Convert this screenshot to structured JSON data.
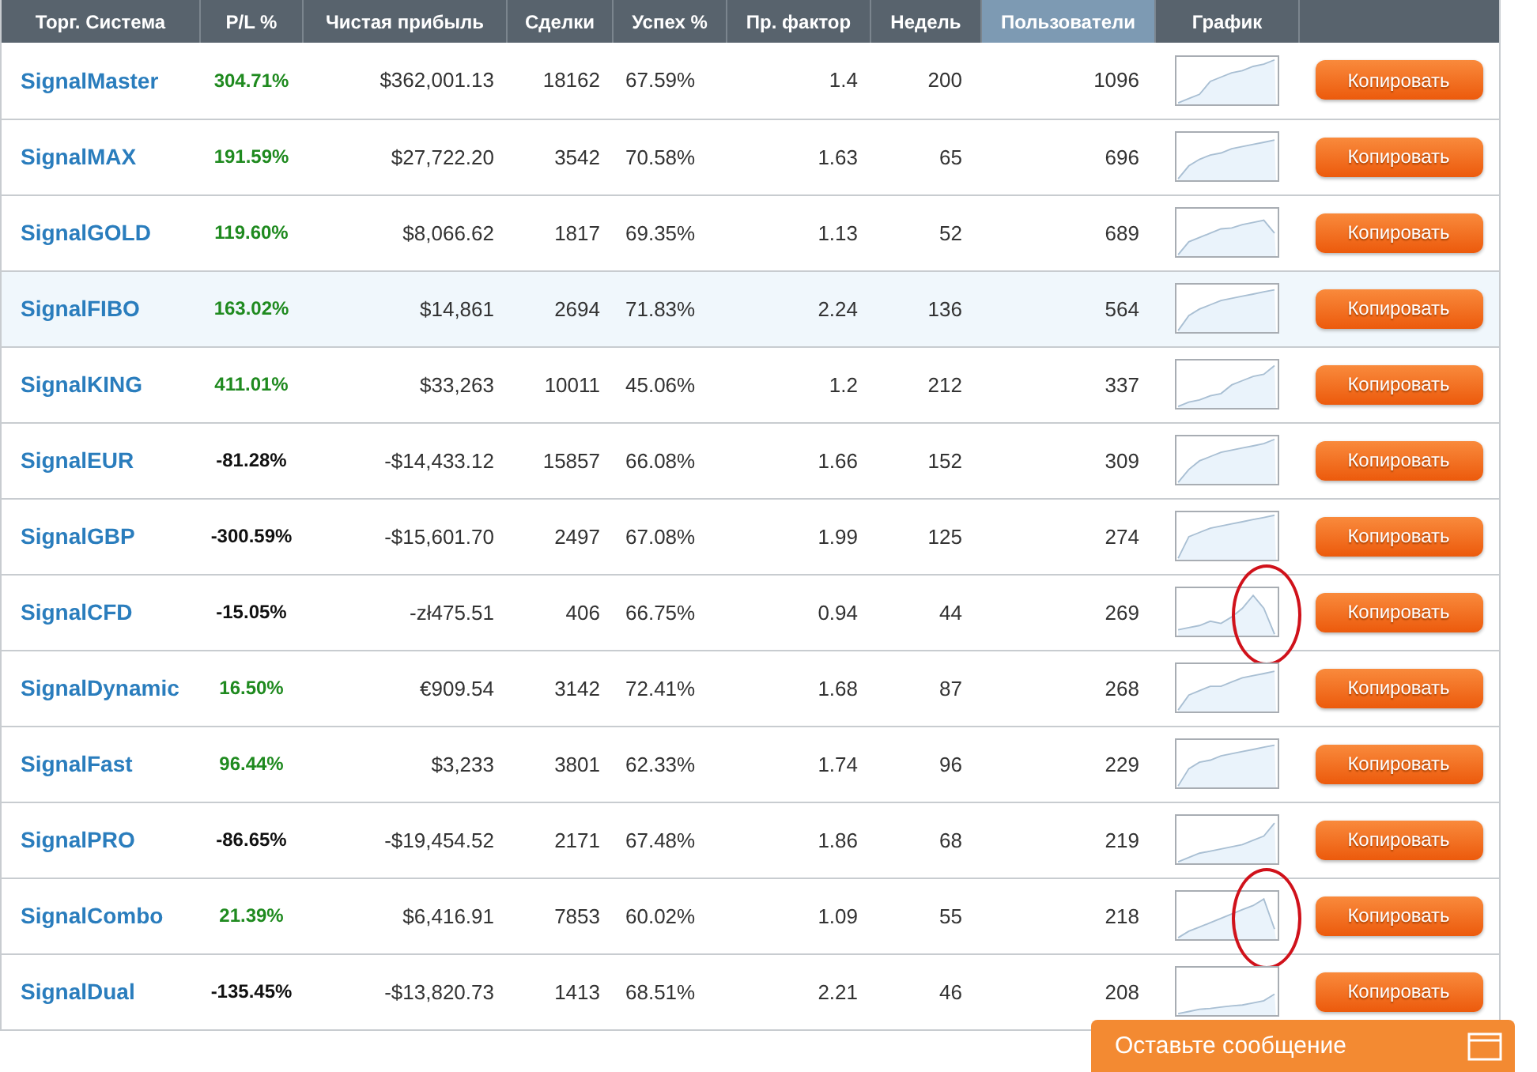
{
  "table": {
    "columns": [
      {
        "label": "Торг. Система",
        "sorted": false
      },
      {
        "label": "P/L %",
        "sorted": false
      },
      {
        "label": "Чистая прибыль",
        "sorted": false
      },
      {
        "label": "Сделки",
        "sorted": false
      },
      {
        "label": "Успех %",
        "sorted": false
      },
      {
        "label": "Пр. фактор",
        "sorted": false
      },
      {
        "label": "Недель",
        "sorted": false
      },
      {
        "label": "Пользователи",
        "sorted": true
      },
      {
        "label": "График",
        "sorted": false
      }
    ],
    "rows": [
      {
        "name": "SignalMaster",
        "pl": "304.71%",
        "positive": true,
        "profit": "$362,001.13",
        "trades": "18162",
        "success": "67.59%",
        "factor": "1.4",
        "weeks": "200",
        "users": "1096",
        "highlighted": false,
        "circled": false,
        "button": "Копировать"
      },
      {
        "name": "SignalMAX",
        "pl": "191.59%",
        "positive": true,
        "profit": "$27,722.20",
        "trades": "3542",
        "success": "70.58%",
        "factor": "1.63",
        "weeks": "65",
        "users": "696",
        "highlighted": false,
        "circled": false,
        "button": "Копировать"
      },
      {
        "name": "SignalGOLD",
        "pl": "119.60%",
        "positive": true,
        "profit": "$8,066.62",
        "trades": "1817",
        "success": "69.35%",
        "factor": "1.13",
        "weeks": "52",
        "users": "689",
        "highlighted": false,
        "circled": false,
        "button": "Копировать"
      },
      {
        "name": "SignalFIBO",
        "pl": "163.02%",
        "positive": true,
        "profit": "$14,861",
        "trades": "2694",
        "success": "71.83%",
        "factor": "2.24",
        "weeks": "136",
        "users": "564",
        "highlighted": true,
        "circled": false,
        "button": "Копировать"
      },
      {
        "name": "SignalKING",
        "pl": "411.01%",
        "positive": true,
        "profit": "$33,263",
        "trades": "10011",
        "success": "45.06%",
        "factor": "1.2",
        "weeks": "212",
        "users": "337",
        "highlighted": false,
        "circled": false,
        "button": "Копировать"
      },
      {
        "name": "SignalEUR",
        "pl": "-81.28%",
        "positive": false,
        "profit": "-$14,433.12",
        "trades": "15857",
        "success": "66.08%",
        "factor": "1.66",
        "weeks": "152",
        "users": "309",
        "highlighted": false,
        "circled": false,
        "button": "Копировать"
      },
      {
        "name": "SignalGBP",
        "pl": "-300.59%",
        "positive": false,
        "profit": "-$15,601.70",
        "trades": "2497",
        "success": "67.08%",
        "factor": "1.99",
        "weeks": "125",
        "users": "274",
        "highlighted": false,
        "circled": false,
        "button": "Копировать"
      },
      {
        "name": "SignalCFD",
        "pl": "-15.05%",
        "positive": false,
        "profit": "-zł475.51",
        "trades": "406",
        "success": "66.75%",
        "factor": "0.94",
        "weeks": "44",
        "users": "269",
        "highlighted": false,
        "circled": true,
        "button": "Копировать"
      },
      {
        "name": "SignalDynamic",
        "pl": "16.50%",
        "positive": true,
        "profit": "€909.54",
        "trades": "3142",
        "success": "72.41%",
        "factor": "1.68",
        "weeks": "87",
        "users": "268",
        "highlighted": false,
        "circled": false,
        "button": "Копировать"
      },
      {
        "name": "SignalFast",
        "pl": "96.44%",
        "positive": true,
        "profit": "$3,233",
        "trades": "3801",
        "success": "62.33%",
        "factor": "1.74",
        "weeks": "96",
        "users": "229",
        "highlighted": false,
        "circled": false,
        "button": "Копировать"
      },
      {
        "name": "SignalPRO",
        "pl": "-86.65%",
        "positive": false,
        "profit": "-$19,454.52",
        "trades": "2171",
        "success": "67.48%",
        "factor": "1.86",
        "weeks": "68",
        "users": "219",
        "highlighted": false,
        "circled": false,
        "button": "Копировать"
      },
      {
        "name": "SignalCombo",
        "pl": "21.39%",
        "positive": true,
        "profit": "$6,416.91",
        "trades": "7853",
        "success": "60.02%",
        "factor": "1.09",
        "weeks": "55",
        "users": "218",
        "highlighted": false,
        "circled": true,
        "button": "Копировать"
      },
      {
        "name": "SignalDual",
        "pl": "-135.45%",
        "positive": false,
        "profit": "-$13,820.73",
        "trades": "1413",
        "success": "68.51%",
        "factor": "2.21",
        "weeks": "46",
        "users": "208",
        "highlighted": false,
        "circled": false,
        "button": "Копировать"
      }
    ]
  },
  "chat_bar": {
    "label": "Оставьте сообщение"
  }
}
